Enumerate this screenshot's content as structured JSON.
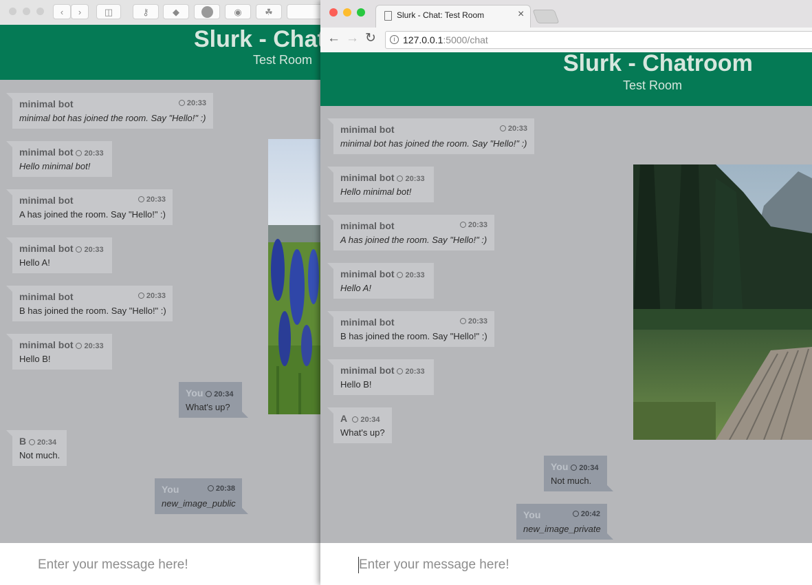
{
  "back_window": {
    "header": {
      "title": "Slurk - Chatr",
      "subtitle": "Test Room"
    },
    "messages": [
      {
        "name": "minimal bot",
        "time": "20:33",
        "text": "minimal bot has joined the room. Say \"Hello!\" :)"
      },
      {
        "name": "minimal bot",
        "time": "20:33",
        "text": "Hello minimal bot!"
      },
      {
        "name": "minimal bot",
        "time": "20:33",
        "text": "A has joined the room. Say \"Hello!\" :)"
      },
      {
        "name": "minimal bot",
        "time": "20:33",
        "text": "Hello A!"
      },
      {
        "name": "minimal bot",
        "time": "20:33",
        "text": "B has joined the room. Say \"Hello!\" :)"
      },
      {
        "name": "minimal bot",
        "time": "20:33",
        "text": "Hello B!"
      },
      {
        "name": "You",
        "time": "20:34",
        "text": "What's up?"
      },
      {
        "name": "B",
        "time": "20:34",
        "text": "Not much."
      },
      {
        "name": "You",
        "time": "20:38",
        "text": "new_image_public"
      }
    ],
    "input_placeholder": "Enter your message here!"
  },
  "front_window": {
    "tab_title": "Slurk - Chat: Test Room",
    "url_host": "127.0.0.1",
    "url_rest": ":5000/chat",
    "header": {
      "title": "Slurk - Chatroom",
      "subtitle": "Test Room"
    },
    "messages": [
      {
        "name": "minimal bot",
        "time": "20:33",
        "text": "minimal bot has joined the room. Say \"Hello!\" :)"
      },
      {
        "name": "minimal bot",
        "time": "20:33",
        "text": "Hello minimal bot!"
      },
      {
        "name": "minimal bot",
        "time": "20:33",
        "text": "A has joined the room. Say \"Hello!\" :)"
      },
      {
        "name": "minimal bot",
        "time": "20:33",
        "text": "Hello A!"
      },
      {
        "name": "minimal bot",
        "time": "20:33",
        "text": "B has joined the room. Say \"Hello!\" :)"
      },
      {
        "name": "minimal bot",
        "time": "20:33",
        "text": "Hello B!"
      },
      {
        "name": "A",
        "time": "20:34",
        "text": "What's up?"
      },
      {
        "name": "You",
        "time": "20:34",
        "text": "Not much."
      },
      {
        "name": "You",
        "time": "20:42",
        "text": "new_image_private"
      }
    ],
    "input_placeholder": "Enter your message here!"
  },
  "colors": {
    "header_green": "#057a55",
    "own_bubble": "#949aa4",
    "other_bubble": "#c6c7ca"
  },
  "icons": [
    "back-arrow-icon",
    "forward-arrow-icon",
    "reload-icon",
    "info-icon",
    "document-icon",
    "close-icon",
    "clock-icon"
  ]
}
